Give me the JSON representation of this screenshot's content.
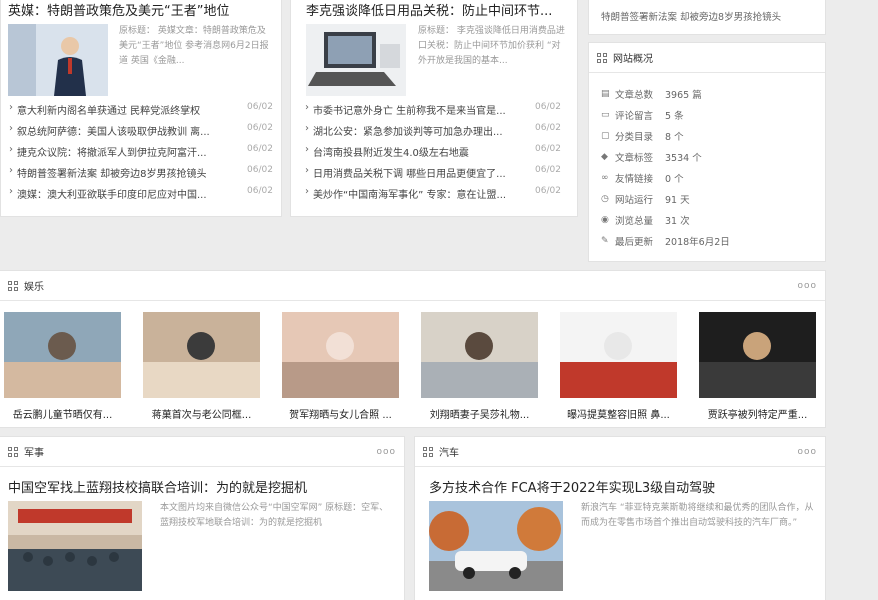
{
  "left_card": {
    "title": "英媒：特朗普政策危及美元“王者”地位",
    "desc": "原标题： 英媒文章：特朗普政策危及美元“王者”地位 参考消息网6月2日报道 英国《金融...",
    "items": [
      {
        "text": "意大利新内阁名单获通过 民粹党派终掌权",
        "date": "06/02"
      },
      {
        "text": "叙总统阿萨德：美国人该吸取伊战教训 离...",
        "date": "06/02"
      },
      {
        "text": "捷克众议院：将撤派军人到伊拉克阿富汗...",
        "date": "06/02"
      },
      {
        "text": "特朗普签署新法案 却被旁边8岁男孩抢镜头",
        "date": "06/02"
      },
      {
        "text": "澳媒：澳大利亚欲联手印度印尼应对中国...",
        "date": "06/02"
      }
    ]
  },
  "mid_card": {
    "title": "李克强谈降低日用品关税：防止中间环节...",
    "desc": "原标题： 李克强谈降低日用消费品进口关税：防止中间环节加价获利 “对外开放是我国的基本...",
    "items": [
      {
        "text": "市委书记意外身亡 生前称我不是来当官是...",
        "date": "06/02"
      },
      {
        "text": "湖北公安：紧急参加谈判等可加急办理出...",
        "date": "06/02"
      },
      {
        "text": "台湾南投县附近发生4.0级左右地震",
        "date": "06/02"
      },
      {
        "text": "日用消费品关税下调 哪些日用品更便宜了...",
        "date": "06/02"
      },
      {
        "text": "美炒作“中国南海军事化” 专家：意在让盟...",
        "date": "06/02"
      }
    ]
  },
  "right_top": {
    "text": "特朗普签署新法案 却被旁边8岁男孩抢镜头"
  },
  "site_overview": {
    "title": "网站概况",
    "stats": [
      {
        "label": "文章总数",
        "value": "3965 篇",
        "icon": "document-icon"
      },
      {
        "label": "评论留言",
        "value": "5 条",
        "icon": "comment-icon"
      },
      {
        "label": "分类目录",
        "value": "8 个",
        "icon": "folder-icon"
      },
      {
        "label": "文章标签",
        "value": "3534 个",
        "icon": "tag-icon"
      },
      {
        "label": "友情链接",
        "value": "0 个",
        "icon": "link-icon"
      },
      {
        "label": "网站运行",
        "value": "91 天",
        "icon": "clock-icon"
      },
      {
        "label": "浏览总量",
        "value": "31 次",
        "icon": "eye-icon"
      },
      {
        "label": "最后更新",
        "value": "2018年6月2日",
        "icon": "edit-icon"
      }
    ]
  },
  "entertainment": {
    "title": "娱乐",
    "more": "ooo",
    "items": [
      {
        "caption": "岳云鹏儿童节晒仅有..."
      },
      {
        "caption": "蒋菓首次与老公同框..."
      },
      {
        "caption": "贺军翔晒与女儿合照 ..."
      },
      {
        "caption": "刘翔晒妻子吴莎礼物..."
      },
      {
        "caption": "曝冯提莫整容旧照 鼻..."
      },
      {
        "caption": "贾跃亭被列特定严重..."
      }
    ]
  },
  "military": {
    "title": "军事",
    "more": "ooo",
    "headline": "中国空军找上蓝翔技校搞联合培训：为的就是挖掘机",
    "desc": "本文图片均来自微信公众号“中国空军网” 原标题：空军、蓝翔技校军地联合培训：为的就是挖掘机"
  },
  "auto": {
    "title": "汽车",
    "more": "ooo",
    "headline": "多方技术合作 FCA将于2022年实现L3级自动驾驶",
    "desc": "新浪汽车 “菲亚特克莱斯勒将继续和最优秀的团队合作，从而成为在零售市场首个推出自动驾驶科技的汽车厂商。”"
  }
}
